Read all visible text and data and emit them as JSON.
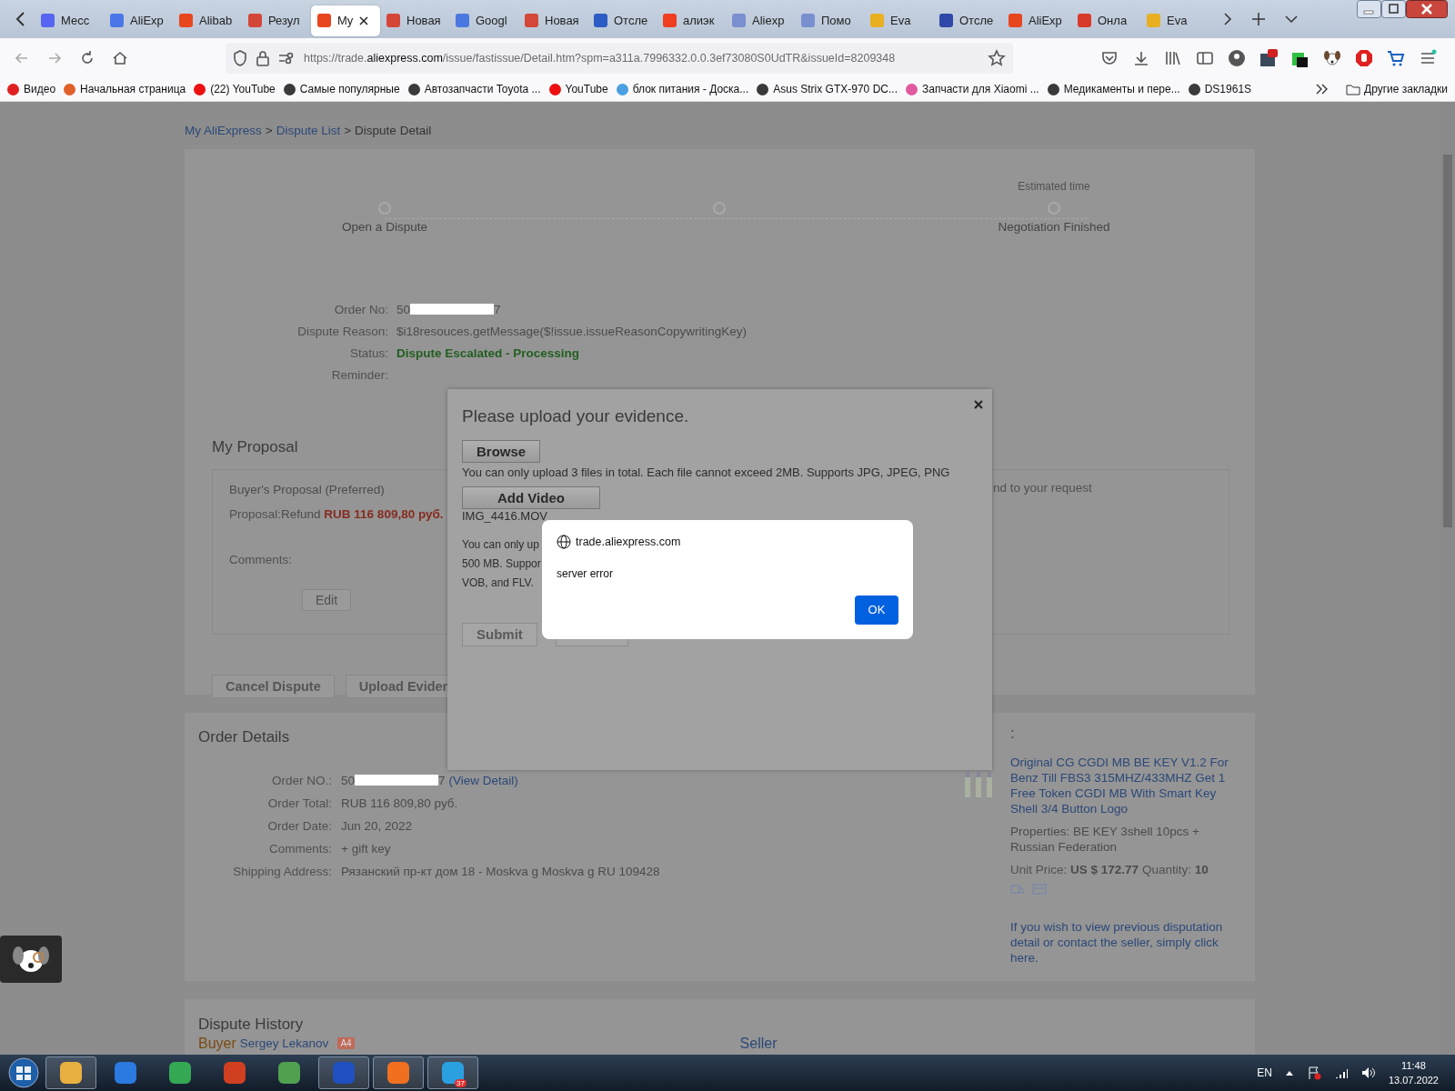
{
  "tabs": [
    {
      "title": "Месс",
      "color": "#5865f2",
      "selected": false
    },
    {
      "title": "AliExp",
      "color": "#4a76e8",
      "selected": false
    },
    {
      "title": "Alibab",
      "color": "#e8461e",
      "selected": false
    },
    {
      "title": "Резул",
      "color": "#d44638",
      "selected": false
    },
    {
      "title": "My",
      "color": "#e8461e",
      "selected": true
    },
    {
      "title": "Новая",
      "color": "#d44638",
      "selected": false
    },
    {
      "title": "Googl",
      "color": "#4a78e0",
      "selected": false
    },
    {
      "title": "Новая",
      "color": "#d44638",
      "selected": false
    },
    {
      "title": "Отсле",
      "color": "#2c5cc4",
      "selected": false
    },
    {
      "title": "алиэк",
      "color": "#f03c20",
      "selected": false
    },
    {
      "title": "Aliexp",
      "color": "#7a8fd0",
      "selected": false
    },
    {
      "title": "Помо",
      "color": "#7a8fd0",
      "selected": false
    },
    {
      "title": "Eva",
      "color": "#e8b020",
      "selected": false
    },
    {
      "title": "Отсле",
      "color": "#3048a8",
      "selected": false
    },
    {
      "title": "AliExp",
      "color": "#e8461e",
      "selected": false
    },
    {
      "title": "Онла",
      "color": "#d83a2a",
      "selected": false
    },
    {
      "title": "Eva",
      "color": "#e8b020",
      "selected": false
    }
  ],
  "address_bar": {
    "url_prefix": "https://trade.",
    "url_domain": "aliexpress.com",
    "url_rest": "/issue/fastissue/Detail.htm?spm=a311a.7996332.0.0.3ef73080S0UdTR&issueId=8209348"
  },
  "bookmarks": [
    {
      "label": "Видео",
      "color": "#e02020"
    },
    {
      "label": "Начальная страница",
      "color": "#e0602a"
    },
    {
      "label": "(22) YouTube",
      "color": "#ee1010"
    },
    {
      "label": "Самые популярные",
      "color": "#3a3a3a"
    },
    {
      "label": "Автозапчасти Toyota ...",
      "color": "#3a3a3a"
    },
    {
      "label": "YouTube",
      "color": "#ee1010"
    },
    {
      "label": "блок питания - Доска...",
      "color": "#4aa0e0"
    },
    {
      "label": "Asus Strix GTX-970 DC...",
      "color": "#3a3a3a"
    },
    {
      "label": "Запчасти для Xiaomi ...",
      "color": "#e05aa0"
    },
    {
      "label": "Медикаменты и пере...",
      "color": "#3a3a3a"
    },
    {
      "label": "DS1961S",
      "color": "#3a3a3a"
    }
  ],
  "other_bookmarks": "Другие закладки",
  "breadcrumb": [
    {
      "label": "My AliExpress",
      "kind": "link"
    },
    {
      "label": ">",
      "kind": "separator"
    },
    {
      "label": "Dispute List",
      "kind": "link"
    },
    {
      "label": ">",
      "kind": "separator"
    },
    {
      "label": "Dispute Detail",
      "kind": "current"
    }
  ],
  "timeline": {
    "steps": [
      {
        "kind": "labeled",
        "label": "Open a Dispute"
      },
      {
        "kind": "dot"
      },
      {
        "kind": "labeled",
        "note": "Estimated time",
        "label": "Negotiation Finished"
      }
    ]
  },
  "info": [
    {
      "label": "Order No:",
      "value": "50",
      "redacted": true,
      "tail": "7"
    },
    {
      "label": "Dispute Reason:",
      "value": "$i18resouces.getMessage($!issue.issueReasonCopywritingKey)"
    },
    {
      "label": "Status:",
      "value": "Dispute Escalated - Processing",
      "kind": "status"
    },
    {
      "label": "Reminder:"
    }
  ],
  "proposal": {
    "heading": "My Proposal",
    "title": "Buyer's Proposal (Preferred)",
    "label": "Proposal:",
    "text": "Refund ",
    "amount": "RUB 116 809,80 руб.",
    "comments": "Comments:",
    "edit": "Edit",
    "side_text": "nd to your request"
  },
  "actions": [
    "Cancel Dispute",
    "Upload Evider"
  ],
  "upload_dialog": {
    "title": "Please upload your evidence.",
    "browse": "Browse",
    "photo_hint": "You can only upload 3 files in total. Each file cannot exceed 2MB. Supports JPG, JPEG, PNG",
    "add_video": "Add Video",
    "file": "IMG_4416.MOV",
    "video_hint": [
      "You can only up",
      "500 MB. Suppor",
      "VOB, and FLV."
    ],
    "submit": "Submit"
  },
  "alert": {
    "host": "trade.aliexpress.com",
    "message": "server error",
    "ok": "OK"
  },
  "order_details": {
    "heading": "Order Details",
    "rows": [
      {
        "label": "Order NO.:",
        "value": "50",
        "redacted": true,
        "tail": "7",
        "link": "(View Detail)"
      },
      {
        "label": "Order Total:",
        "value": "RUB 116 809,80 руб."
      },
      {
        "label": "Order Date:",
        "value": "Jun 20, 2022"
      },
      {
        "label": "Comments:",
        "value": "+ gift key"
      },
      {
        "label": "Shipping Address:",
        "value": "Рязанский пр-кт дом 18 - Moskva g Moskva g RU 109428"
      }
    ],
    "product": {
      "heading": ":",
      "title": "Original CG CGDI MB BE KEY V1.2 For Benz Till FBS3 315MHZ/433MHZ Get 1 Free Token CGDI MB With Smart Key Shell 3/4 Button Logo",
      "properties": "Properties: BE KEY 3shell 10pcs + Russian Federation",
      "price_label": "Unit Price:",
      "price": "US $ 172.77",
      "qty_label": "Quantity:",
      "qty": "10",
      "note": "If you wish to view previous disputation detail or contact the seller, simply click here."
    }
  },
  "dispute_history": {
    "heading": "Dispute History",
    "buyer_label": "Buyer",
    "buyer_name": "Sergey Lekanov",
    "badge": "A4",
    "seller_label": "Seller"
  },
  "taskbar": {
    "apps": [
      {
        "color": "#e8b040",
        "active": true
      },
      {
        "color": "#2a7ae0",
        "active": false
      },
      {
        "color": "#34a853",
        "active": false
      },
      {
        "color": "#d04020",
        "active": false
      },
      {
        "color": "#50a050",
        "active": false
      },
      {
        "color": "#2050c0",
        "active": true
      },
      {
        "color": "#f07020",
        "active": true
      },
      {
        "color": "#2aa0e0",
        "active": true,
        "badge": "37"
      }
    ],
    "language": "EN",
    "time": "11:48",
    "date": "13.07.2022"
  }
}
